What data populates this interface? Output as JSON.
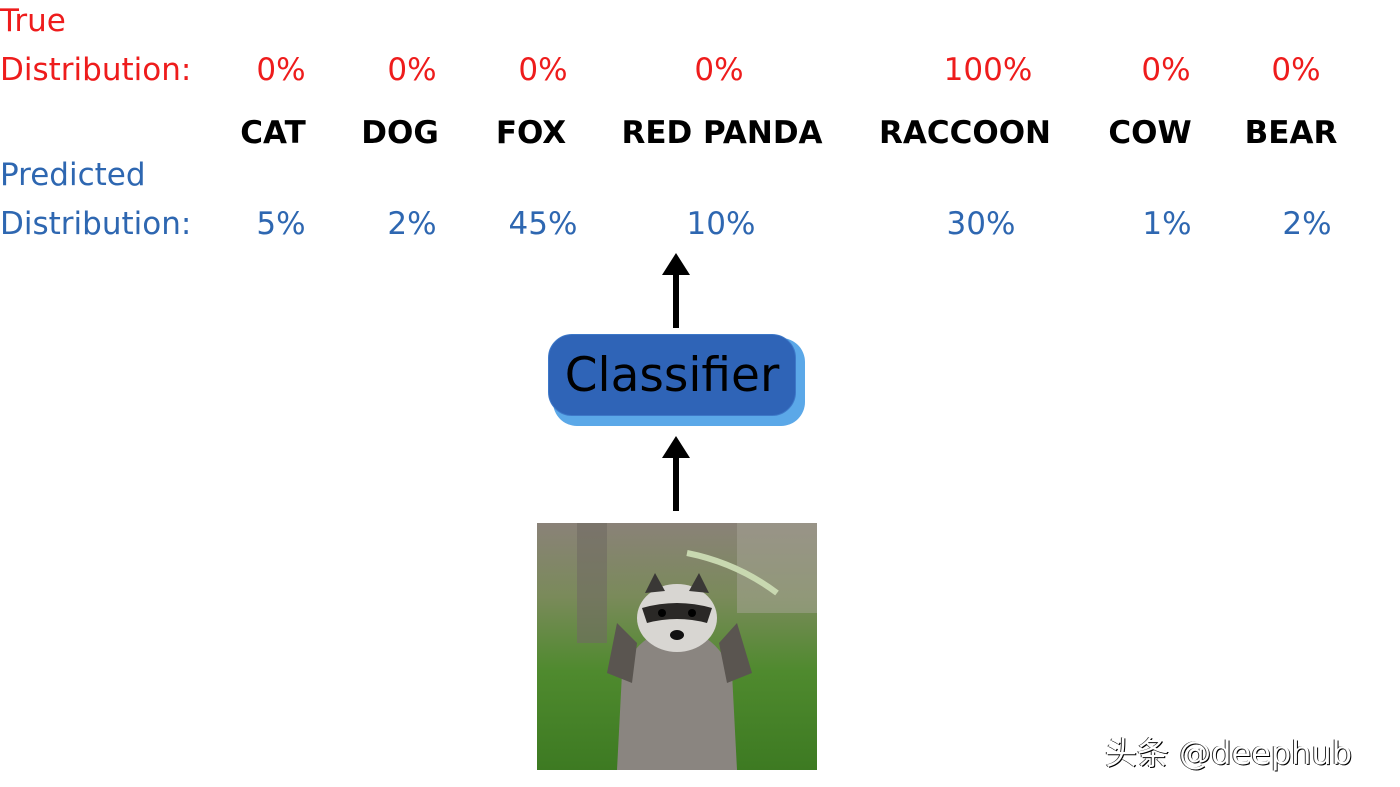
{
  "true_label": [
    "True",
    "Distribution:"
  ],
  "predicted_label": [
    "Predicted",
    "Distribution:"
  ],
  "classes": [
    "CAT",
    "DOG",
    "FOX",
    "RED PANDA",
    "RACCOON",
    "COW",
    "BEAR"
  ],
  "true_distribution": [
    "0%",
    "0%",
    "0%",
    "0%",
    "100%",
    "0%",
    "0%"
  ],
  "predicted_distribution": [
    "5%",
    "2%",
    "45%",
    "10%",
    "30%",
    "1%",
    "2%"
  ],
  "classifier_label": "Classifier",
  "watermark": "头条 @deephub",
  "colors": {
    "true": "#ee1c1c",
    "predicted": "#2e67b1",
    "classifier": "#2f64b7",
    "classifier_shadow": "#5ba8e8"
  }
}
